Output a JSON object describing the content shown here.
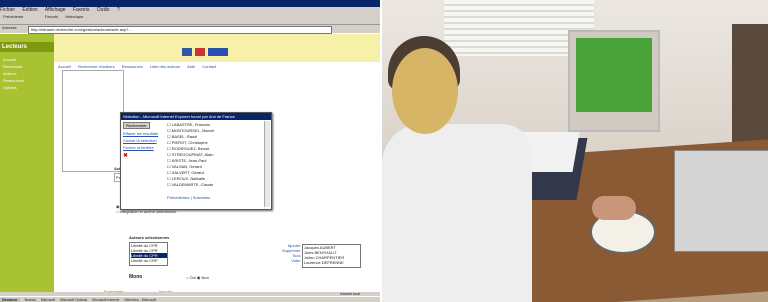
{
  "left_screenshot": {
    "menu": [
      "Fichier",
      "Edition",
      "Affichage",
      "Favoris",
      "Outils",
      "?"
    ],
    "toolbar": {
      "back": "Précédente",
      "favorites": "Favoris",
      "history": "Historique"
    },
    "address": {
      "label": "Adresse",
      "value": "http://intranet.recherche.com/gestion/acteurs/sele.asp?..."
    },
    "sidebar": {
      "header": "Lecteurs",
      "items": [
        "Accueil",
        "Recherche",
        "Acteurs",
        "Ressources",
        "Options"
      ]
    },
    "nav_links": [
      "Accueil",
      "Recherche d'acteurs",
      "Ressources",
      "Liste des acteurs",
      "Aide",
      "Contact"
    ],
    "dialog": {
      "title": "Sélection - Microsoft Internet Explorer fourni par Ami de France",
      "search_button": "Rechercher",
      "links": [
        "Effacer les résultats",
        "Choisir la sélection",
        "Fermer la fenêtre"
      ],
      "entries": [
        "LABASTRE, Francois",
        "MONTOURSEL, Marcel",
        "BASEL, Raoul",
        "PIEROT, Christophe",
        "RODRIGUEZ, Benoit",
        "STREGOUPINAT, Alain",
        "KRISTE, Jean-Paul",
        "VALSAN, Gérard",
        "SALVERT, Gérard",
        "LEROUX, Nathalie",
        "VALDEMARTE, Claude"
      ],
      "footer": "Précédentes | Suivantes"
    },
    "selector": {
      "label": "Acteur 2d",
      "tree_item": "Pouvoirs/Sujets/Rapports",
      "options": [
        "Acteur désigné",
        "Intégration et acteur sélectionné"
      ]
    },
    "list_header": "Acteurs sélectionnés",
    "left_list": [
      "Libellé du CPR",
      "Libellé du CPR",
      "Libellé du CPR",
      "Libellé du CRP"
    ],
    "right_links": [
      "Ajouter",
      "Supprimer",
      "Tous",
      "Vider"
    ],
    "right_list": [
      "Jacques AUBERT",
      "Jules BENYHALIT",
      "Julien CHARPENTIER",
      "Laurence DEFRENNE"
    ],
    "row_label": "Mono",
    "radio_opts": [
      "Oui",
      "Non"
    ],
    "bottom_buttons": [
      "Enregistrer",
      "Annuler"
    ],
    "status_text": "Intranet local",
    "taskbar": [
      "Démarrer",
      "Bureau",
      "Microsoft",
      "Microsoft Outlook",
      "Microsoft Internet",
      "Sélection - Microsoft"
    ]
  }
}
